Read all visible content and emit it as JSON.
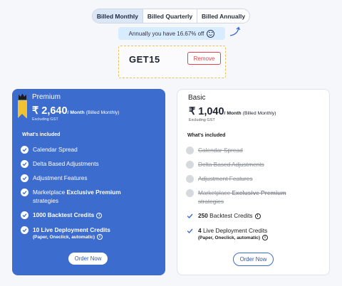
{
  "billing": {
    "options": [
      "Billed Monthly",
      "Billed Quarterly",
      "Billed Annually"
    ],
    "active": 0,
    "savings_text": "Annually you have 16.67% off"
  },
  "coupon": {
    "code": "GET15",
    "remove_label": "Remove"
  },
  "plans": {
    "premium": {
      "name": "Premium",
      "price": "₹ 2,640",
      "per": "/ Month",
      "billing": "(Billed Monthly)",
      "tax_note": "Excluding GST",
      "included_label": "What's included",
      "features": [
        "Calendar Spread",
        "Delta Based Adjustments",
        "Adjustment Features",
        "Marketplace",
        "Exclusive Premium",
        "strategies",
        "1000 Backtest Credits",
        "10 Live Deployment Credits",
        "(Paper, Oneclick, automatic)"
      ],
      "order_label": "Order Now"
    },
    "basic": {
      "name": "Basic",
      "price": "₹ 1,040",
      "per": "/ Month",
      "billing": "(Billed Monthly)",
      "tax_note": "Excluding GST",
      "included_label": "What's included",
      "features": [
        "Calendar Spread",
        "Delta Based Adjustments",
        "Adjustment Features",
        "Marketplace",
        "Exclusive Premium",
        "strategies",
        "250",
        "Backtest Credits",
        "4",
        "Live Deployment Credits",
        "(Paper, Oneclick, automatic)"
      ],
      "order_label": "Order Now"
    }
  },
  "colors": {
    "accent": "#3d6ccf",
    "badge": "#f2c230",
    "danger": "#e0434f"
  }
}
